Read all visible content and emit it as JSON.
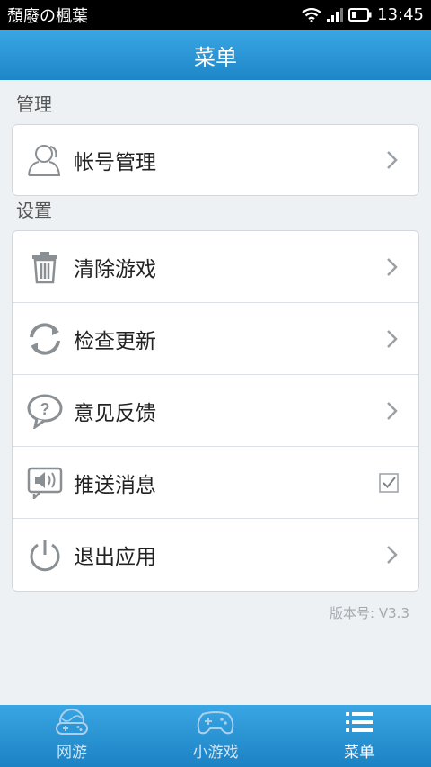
{
  "status_bar": {
    "carrier": "頹廢の楓葉",
    "time": "13:45"
  },
  "header": {
    "title": "菜单"
  },
  "sections": {
    "manage": {
      "title": "管理",
      "items": [
        {
          "label": "帐号管理",
          "icon": "user-icon"
        }
      ]
    },
    "settings": {
      "title": "设置",
      "items": [
        {
          "label": "清除游戏",
          "icon": "trash-icon"
        },
        {
          "label": "检查更新",
          "icon": "refresh-icon"
        },
        {
          "label": "意见反馈",
          "icon": "feedback-icon"
        },
        {
          "label": "推送消息",
          "icon": "speaker-icon",
          "checked": true
        },
        {
          "label": "退出应用",
          "icon": "power-icon"
        }
      ]
    }
  },
  "version": "版本号: V3.3",
  "bottom_nav": {
    "items": [
      {
        "label": "网游",
        "icon": "globe-gamepad-icon",
        "active": false
      },
      {
        "label": "小游戏",
        "icon": "gamepad-icon",
        "active": false
      },
      {
        "label": "菜单",
        "icon": "menu-list-icon",
        "active": true
      }
    ]
  },
  "colors": {
    "accent": "#1e86c8",
    "header_top": "#3aa6e4",
    "background": "#eef1f4"
  }
}
